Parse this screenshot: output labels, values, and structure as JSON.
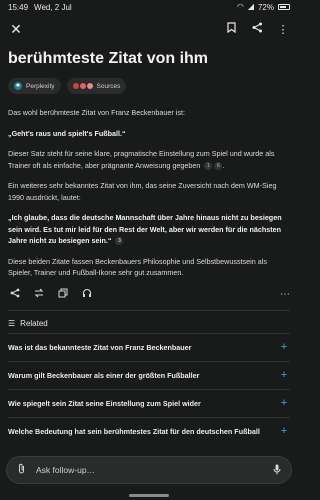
{
  "status": {
    "time": "15:49",
    "date": "Wed, 2 Jul",
    "battery": "72%"
  },
  "topbar": {
    "close_icon": "close-icon",
    "bookmark_icon": "bookmark-icon",
    "share_icon": "share-icon",
    "more_icon": "more-vertical-icon"
  },
  "answer": {
    "title": "berühmteste Zitat von ihm",
    "chips": {
      "model": "Perplexity",
      "sources": "Sources"
    },
    "p1": "Das wohl berühmteste Zitat von Franz Beckenbauer ist:",
    "quote1": "„Geht's raus und spielt's Fußball.“",
    "p2": "Dieser Satz steht für seine klare, pragmatische Einstellung zum Spiel und wurde als Trainer oft als einfache, aber prägnante Anweisung gegeben",
    "p2_cites": [
      "1",
      "6"
    ],
    "p3": "Ein weiteres sehr bekanntes Zitat von ihm, das seine Zuversicht nach dem WM-Sieg 1990 ausdrückt, lautet:",
    "quote2": "„Ich glaube, dass die deutsche Mannschaft über Jahre hinaus nicht zu besiegen sein wird. Es tut mir leid für den Rest der Welt, aber wir werden für die nächsten Jahre nicht zu besiegen sein.“",
    "quote2_cite": "3",
    "p4": "Diese beiden Zitate fassen Beckenbauers Philosophie und Selbstbewusstsein als Spieler, Trainer und Fußball-Ikone sehr gut zusammen."
  },
  "related": {
    "heading": "Related",
    "items": [
      "Was ist das bekannteste Zitat von Franz Beckenbauer",
      "Warum gilt Beckenbauer als einer der größten Fußballer",
      "Wie spiegelt sein Zitat seine Einstellung zum Spiel wider",
      "Welche Bedeutung hat sein berühmtestes Zitat für den deutschen Fußball"
    ]
  },
  "followup": {
    "placeholder": "Ask follow-up…"
  },
  "colors": {
    "accent": "#20b8cd",
    "background": "#191a1a"
  }
}
